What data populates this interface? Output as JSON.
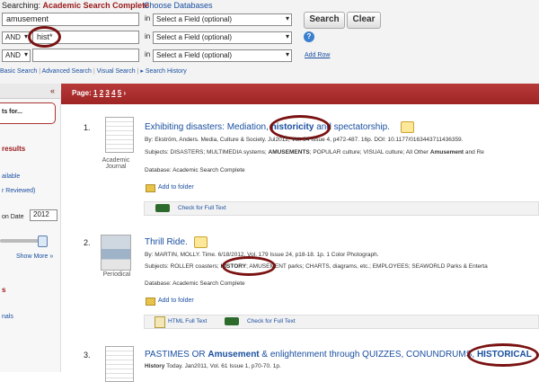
{
  "searching_label": "Searching:",
  "database_name": "Academic Search Complete",
  "choose_databases": "Choose Databases",
  "row1": {
    "value": "amusement",
    "field": "Select a Field (optional)"
  },
  "row2": {
    "op": "AND",
    "value": "hist*",
    "field": "Select a Field (optional)"
  },
  "row3": {
    "op": "AND",
    "value": "",
    "field": "Select a Field (optional)"
  },
  "in_label": "in",
  "search_button": "Search",
  "clear_button": "Clear",
  "help_icon": "?",
  "add_row": "Add Row",
  "nav": {
    "basic": "Basic Search",
    "advanced": "Advanced Search",
    "visual": "Visual Search",
    "history": "Search History"
  },
  "left": {
    "collapse": "«",
    "refine_partial": "ts for...",
    "results_partial": "results",
    "available_partial": "ailable",
    "reviewed_partial": "r Reviewed)",
    "date_partial": "on Date",
    "year": "2012",
    "show_more": "Show More »",
    "s_partial": "s",
    "journals_partial": "nals"
  },
  "page_label": "Page:",
  "pages": [
    "1",
    "2",
    "3",
    "4",
    "5"
  ],
  "next": "›",
  "results": [
    {
      "num": "1.",
      "title_pre": "Exhibiting disasters: Mediation, ",
      "title_hl": "historicity",
      "title_post": " and spectatorship.",
      "byline": "By: Ekström, Anders. Media, Culture & Society. Jul2012, Vol. 34 Issue 4, p472-487. 16p. DOI: 10.1177/0163443711436359.",
      "subjects_pre": "Subjects: DISASTERS; MULTIMEDIA systems; ",
      "subjects_hl": "AMUSEMENTS",
      "subjects_post": "; POPULAR culture; VISUAL culture; All Other ",
      "subjects_hl2": "Amusement",
      "subjects_post2": " and Re",
      "database": "Database: Academic Search Complete",
      "add_folder": "Add to folder",
      "check_full_text": "Check for Full Text",
      "type_line1": "Academic",
      "type_line2": "Journal"
    },
    {
      "num": "2.",
      "title": "Thrill Ride.",
      "byline": "By: MARTIN, MOLLY. Time. 6/18/2012, Vol. 179 Issue 24, p18-18. 1p. 1 Color Photograph.",
      "subjects_pre": "Subjects: ROLLER coasters; ",
      "subjects_hl": "HISTORY",
      "subjects_post": "; AMUSEMENT parks; CHARTS, diagrams, etc.; EMPLOYEES; SEAWORLD Parks & Enterta",
      "database": "Database: Academic Search Complete",
      "add_folder": "Add to folder",
      "html_full_text": "HTML Full Text",
      "check_full_text": "Check for Full Text",
      "type_line1": "Periodical"
    },
    {
      "num": "3.",
      "title_pre": "PASTIMES OR ",
      "title_hl": "Amusement",
      "title_mid": " & enlightenment through QUIZZES, CONUNDRUMS, ",
      "title_hl2": "HISTORICAL",
      "byline_hl": "History",
      "byline": " Today. Jan2011, Vol. 61 Issue 1, p70-70. 1p."
    }
  ]
}
